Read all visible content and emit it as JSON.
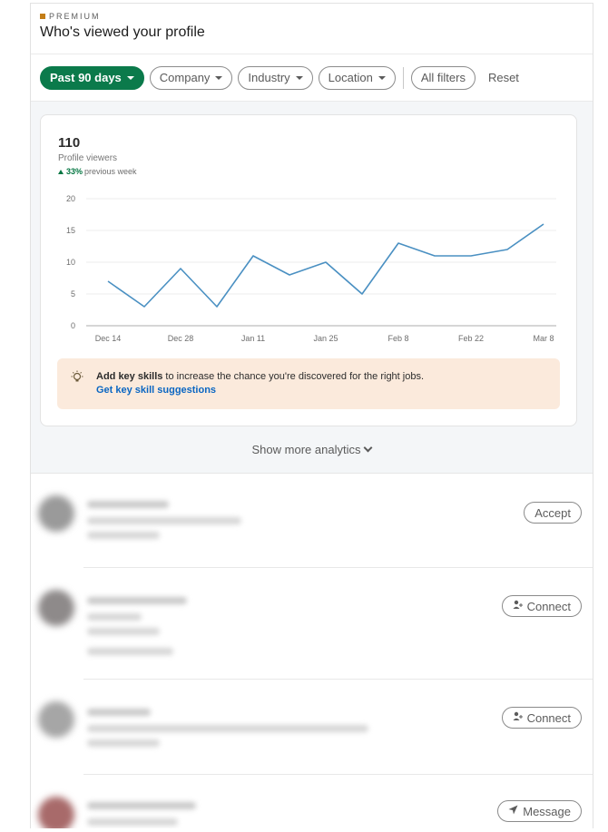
{
  "header": {
    "premium_label": "PREMIUM",
    "title": "Who's viewed your profile"
  },
  "filters": {
    "active": "Past 90 days",
    "items": [
      "Company",
      "Industry",
      "Location"
    ],
    "all_filters": "All filters",
    "reset": "Reset"
  },
  "summary": {
    "count": "110",
    "label": "Profile viewers",
    "trend_value": "33%",
    "trend_label": "previous week"
  },
  "chart_data": {
    "type": "line",
    "x": [
      "Dec 14",
      "Dec 21",
      "Dec 28",
      "Jan 4",
      "Jan 11",
      "Jan 18",
      "Jan 25",
      "Feb 1",
      "Feb 8",
      "Feb 15",
      "Feb 22",
      "Mar 1",
      "Mar 8"
    ],
    "series": [
      {
        "values": [
          7,
          3,
          9,
          3,
          11,
          8,
          10,
          5,
          13,
          11,
          11,
          12,
          16
        ]
      }
    ],
    "x_tick_labels": [
      "Dec 14",
      "Dec 28",
      "Jan 11",
      "Jan 25",
      "Feb 8",
      "Feb 22",
      "Mar 8"
    ],
    "y_ticks": [
      0,
      5,
      10,
      15,
      20
    ],
    "ylim": [
      0,
      20
    ],
    "grid": true,
    "line_color": "#4a90c2",
    "title": "",
    "xlabel": "",
    "ylabel": ""
  },
  "tip": {
    "bold": "Add key skills",
    "text": " to increase the chance you're discovered for the right jobs.",
    "link": "Get key skill suggestions"
  },
  "show_more": "Show more analytics",
  "viewers": [
    {
      "action": "Accept",
      "action_icon": ""
    },
    {
      "action": "Connect",
      "action_icon": "person-add-icon"
    },
    {
      "action": "Connect",
      "action_icon": "person-add-icon"
    },
    {
      "action": "Message",
      "action_icon": "send-icon"
    }
  ],
  "colors": {
    "accent_green": "#0b7a4b",
    "link_blue": "#0a66c2",
    "tip_bg": "#fbeadc"
  }
}
